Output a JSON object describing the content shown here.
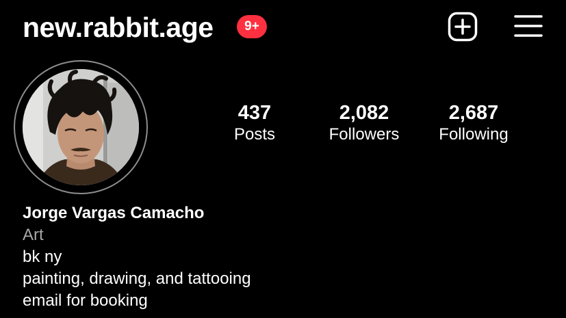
{
  "header": {
    "username": "new.rabbit.age",
    "notifications_badge": "9+",
    "create_icon": "plus-square-icon",
    "menu_icon": "hamburger-menu-icon"
  },
  "profile": {
    "avatar": "profile-photo",
    "stats": [
      {
        "value": "437",
        "label": "Posts"
      },
      {
        "value": "2,082",
        "label": "Followers"
      },
      {
        "value": "2,687",
        "label": "Following"
      }
    ]
  },
  "bio": {
    "name": "Jorge Vargas Camacho",
    "category": "Art",
    "lines": [
      "bk ny",
      "painting, drawing, and tattooing",
      "email for booking"
    ]
  },
  "colors": {
    "background": "#000000",
    "text": "#ffffff",
    "secondary_text": "#a8a8a8",
    "badge": "#ff3040",
    "avatar_ring": "#8e8e8e"
  }
}
